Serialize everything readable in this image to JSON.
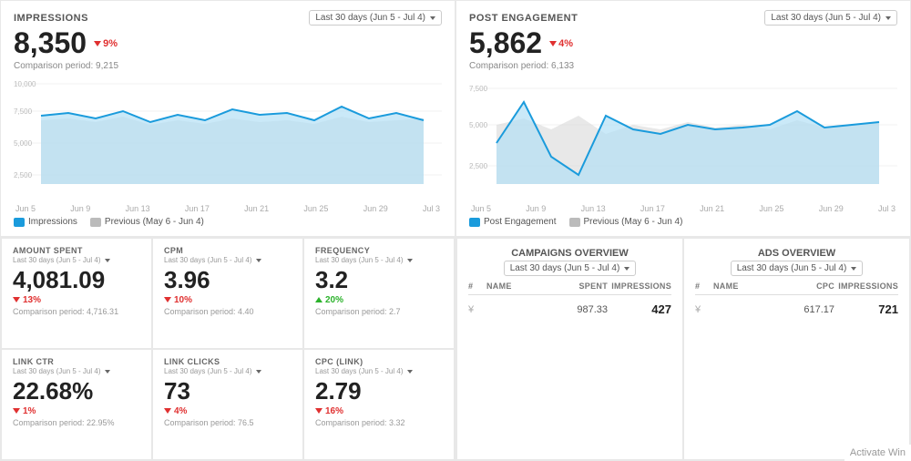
{
  "impressions_chart": {
    "title": "IMPRESSIONS",
    "date_range": "Last 30 days (Jun 5 - Jul 4)",
    "value": "8,350",
    "change_pct": "9%",
    "change_dir": "down",
    "comparison_label": "Comparison period: 9,215",
    "legend_current": "Impressions",
    "legend_previous": "Previous (May 6 - Jun 4)",
    "x_labels": [
      "Jun 5",
      "Jun 9",
      "Jun 13",
      "Jun 17",
      "Jun 21",
      "Jun 25",
      "Jun 29",
      "Jul 3"
    ],
    "y_labels": [
      "10,000",
      "7,500",
      "5,000",
      "2,500"
    ]
  },
  "engagement_chart": {
    "title": "POST ENGAGEMENT",
    "date_range": "Last 30 days (Jun 5 - Jul 4)",
    "value": "5,862",
    "change_pct": "4%",
    "change_dir": "down",
    "comparison_label": "Comparison period: 6,133",
    "legend_current": "Post Engagement",
    "legend_previous": "Previous (May 6 - Jun 4)",
    "x_labels": [
      "Jun 5",
      "Jun 9",
      "Jun 13",
      "Jun 17",
      "Jun 21",
      "Jun 25",
      "Jun 29",
      "Jul 3"
    ],
    "y_labels": [
      "7,500",
      "5,000",
      "2,500"
    ]
  },
  "metrics": [
    {
      "title": "AMOUNT SPENT",
      "date": "Last 30 days (Jun 5 - Jul 4)",
      "value": "4,081.09",
      "change_pct": "13%",
      "change_dir": "down",
      "comparison": "Comparison period: 4,716.31"
    },
    {
      "title": "CPM",
      "date": "Last 30 days (Jun 5 - Jul 4)",
      "value": "3.96",
      "change_pct": "10%",
      "change_dir": "down",
      "comparison": "Comparison period: 4.40"
    },
    {
      "title": "FREQUENCY",
      "date": "Last 30 days (Jun 5 - Jul 4)",
      "value": "3.2",
      "change_pct": "20%",
      "change_dir": "up",
      "comparison": "Comparison period: 2.7"
    },
    {
      "title": "LINK CTR",
      "date": "Last 30 days (Jun 5 - Jul 4)",
      "value": "22.68%",
      "change_pct": "1%",
      "change_dir": "down",
      "comparison": "Comparison period: 22.95%"
    },
    {
      "title": "LINK CLICKS",
      "date": "Last 30 days (Jun 5 - Jul 4)",
      "value": "73",
      "change_pct": "4%",
      "change_dir": "down",
      "comparison": "Comparison period: 76.5"
    },
    {
      "title": "CPC (LINK)",
      "date": "Last 30 days (Jun 5 - Jul 4)",
      "value": "2.79",
      "change_pct": "16%",
      "change_dir": "down",
      "comparison": "Comparison period: 3.32"
    }
  ],
  "campaigns_overview": {
    "title": "CAMPAIGNS OVERVIEW",
    "date_range": "Last 30 days (Jun 5 - Jul 4)",
    "columns": [
      "#",
      "NAME",
      "SPENT",
      "IMPRESSIONS"
    ],
    "rows": [
      {
        "num": "¥",
        "name": "",
        "spent": "987.33",
        "impressions": "427"
      }
    ]
  },
  "ads_overview": {
    "title": "ADS OVERVIEW",
    "date_range": "Last 30 days (Jun 5 - Jul 4)",
    "columns": [
      "#",
      "NAME",
      "CPC",
      "IMPRESSIONS"
    ],
    "rows": [
      {
        "num": "¥",
        "name": "",
        "cpc": "617.17",
        "impressions": "721"
      }
    ]
  },
  "activate_windows": "Activate Win"
}
